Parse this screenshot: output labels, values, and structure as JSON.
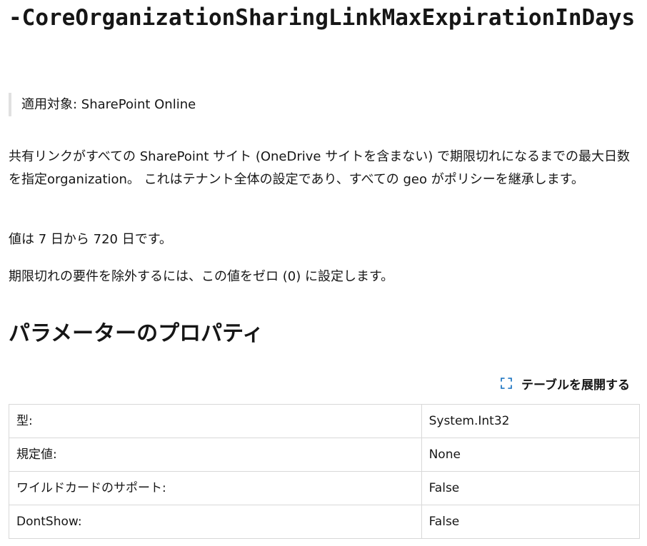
{
  "parameter": {
    "name": "-CoreOrganizationSharingLinkMaxExpirationInDays"
  },
  "applies_to": "適用対象: SharePoint Online",
  "description": [
    "共有リンクがすべての SharePoint サイト (OneDrive サイトを含まない) で期限切れになるまでの最大日数を指定organization。 これはテナント全体の設定であり、すべての geo がポリシーを継承します。",
    "値は 7 日から 720 日です。",
    "期限切れの要件を除外するには、この値をゼロ (0) に設定します。"
  ],
  "properties_section": {
    "heading": "パラメーターのプロパティ",
    "expand_label": "テーブルを展開する",
    "expand_icon": "expand-icon",
    "accent_color": "#0f6cbd",
    "rows": [
      {
        "key": "型:",
        "value": "System.Int32"
      },
      {
        "key": "規定値:",
        "value": "None"
      },
      {
        "key": "ワイルドカードのサポート:",
        "value": "False"
      },
      {
        "key": "DontShow:",
        "value": "False"
      }
    ]
  }
}
